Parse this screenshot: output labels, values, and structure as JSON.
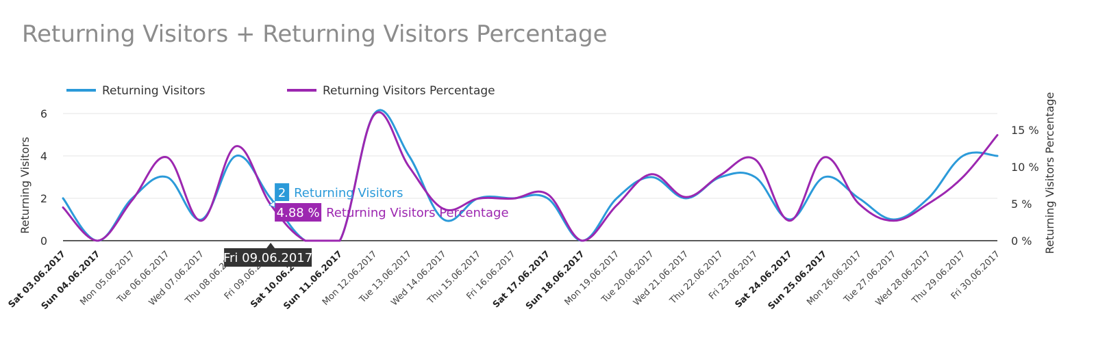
{
  "chart_data": {
    "type": "line",
    "title": "Returning Visitors + Returning Visitors Percentage",
    "categories": [
      "Sat 03.06.2017",
      "Sun 04.06.2017",
      "Mon 05.06.2017",
      "Tue 06.06.2017",
      "Wed 07.06.2017",
      "Thu 08.06.2017",
      "Fri 09.06.2017",
      "Sat 10.06.2017",
      "Sun 11.06.2017",
      "Mon 12.06.2017",
      "Tue 13.06.2017",
      "Wed 14.06.2017",
      "Thu 15.06.2017",
      "Fri 16.06.2017",
      "Sat 17.06.2017",
      "Sun 18.06.2017",
      "Mon 19.06.2017",
      "Tue 20.06.2017",
      "Wed 21.06.2017",
      "Thu 22.06.2017",
      "Fri 23.06.2017",
      "Sat 24.06.2017",
      "Sun 25.06.2017",
      "Mon 26.06.2017",
      "Tue 27.06.2017",
      "Wed 28.06.2017",
      "Thu 29.06.2017",
      "Fri 30.06.2017"
    ],
    "weekend": [
      true,
      true,
      false,
      false,
      false,
      false,
      false,
      true,
      true,
      false,
      false,
      false,
      false,
      false,
      true,
      true,
      false,
      false,
      false,
      false,
      false,
      true,
      true,
      false,
      false,
      false,
      false,
      false
    ],
    "series": [
      {
        "name": "Returning Visitors",
        "axis": "left",
        "color": "#2b9ad9",
        "values": [
          2,
          0,
          2,
          3,
          1,
          4,
          2,
          0,
          0,
          6,
          4,
          1,
          2,
          2,
          2,
          0,
          2,
          3,
          2,
          3,
          3,
          1,
          3,
          2,
          1,
          2,
          4,
          4
        ]
      },
      {
        "name": "Returning Visitors Percentage",
        "axis": "right",
        "color": "#9c27b0",
        "values": [
          4.5,
          0,
          5.5,
          11.3,
          2.7,
          12.8,
          4.88,
          0,
          0,
          17.1,
          10,
          4.3,
          5.7,
          5.7,
          6.3,
          0,
          4.8,
          9,
          5.9,
          8.9,
          11,
          2.7,
          11.3,
          5,
          2.7,
          5,
          8.6,
          14.3
        ]
      }
    ],
    "y_left": {
      "label": "Returning Visitors",
      "ticks": [
        0,
        2,
        4,
        6
      ],
      "range": [
        0,
        6
      ]
    },
    "y_right": {
      "label": "Returning Visitors Percentage",
      "ticks": [
        "0 %",
        "5 %",
        "10 %",
        "15 %"
      ],
      "tick_values": [
        0,
        5,
        10,
        15
      ],
      "range": [
        0,
        17
      ]
    },
    "legend": {
      "position": "top-left"
    },
    "grid": true,
    "tooltip": {
      "date": "Fri 09.06.2017",
      "index": 6,
      "visitors_value": "2",
      "visitors_label": "Returning Visitors",
      "percent_value": "4.88 %",
      "percent_label": "Returning Visitors Percentage"
    }
  }
}
